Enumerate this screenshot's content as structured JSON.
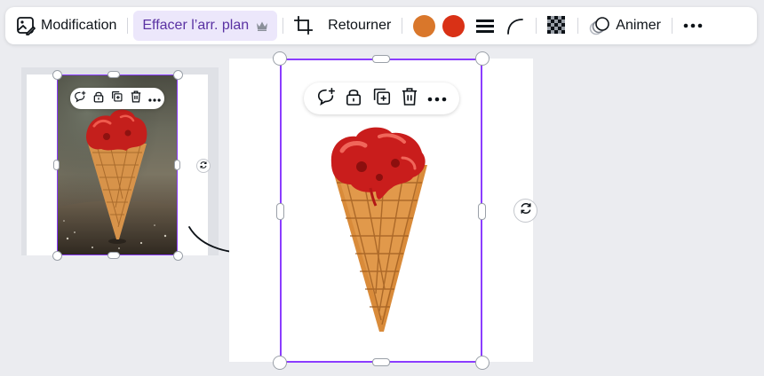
{
  "toolbar": {
    "modification_label": "Modification",
    "remove_bg_label": "Effacer l’arr. plan",
    "flip_label": "Retourner",
    "animate_label": "Animer",
    "color_1": "#d9772b",
    "color_2": "#d93116"
  },
  "icons": {
    "edit_image": "edit-image-icon",
    "crown": "crown-icon",
    "crop": "crop-icon",
    "border_style": "border-style-icon",
    "corner_radius": "corner-radius-icon",
    "transparency": "transparency-icon",
    "animate": "animate-icon",
    "more": "more-icon",
    "comment": "add-comment-icon",
    "lock": "lock-icon",
    "duplicate": "duplicate-icon",
    "delete": "trash-icon",
    "rotate": "rotate-icon",
    "arrow": "arrow-icon"
  },
  "colors": {
    "selection": "#8b3dff",
    "remove_bg_tab": "#ece7fb",
    "workspace": "#ebecf0"
  }
}
